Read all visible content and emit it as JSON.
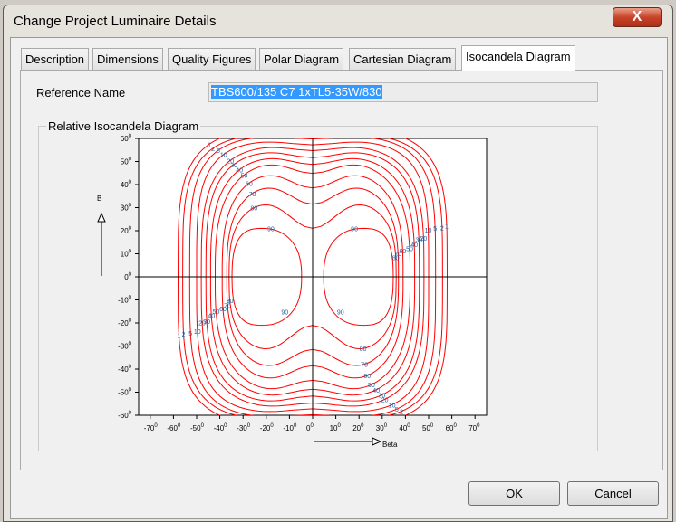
{
  "window": {
    "title": "Change Project Luminaire Details",
    "close_label": "X"
  },
  "tabs": [
    {
      "label": "Description"
    },
    {
      "label": "Dimensions"
    },
    {
      "label": "Quality Figures"
    },
    {
      "label": "Polar Diagram"
    },
    {
      "label": "Cartesian Diagram"
    },
    {
      "label": "Isocandela Diagram",
      "active": true
    }
  ],
  "form": {
    "reference_label": "Reference Name",
    "reference_value": "TBS600/135 C7 1xTL5-35W/830"
  },
  "group": {
    "title": "Relative Isocandela Diagram"
  },
  "chart_data": {
    "type": "contour",
    "xlabel": "Beta",
    "ylabel": "B",
    "xlim": [
      -75,
      75
    ],
    "ylim": [
      -60,
      60
    ],
    "xticks": [
      -70,
      -60,
      -50,
      -40,
      -30,
      -20,
      -10,
      0,
      10,
      20,
      30,
      40,
      50,
      60,
      70
    ],
    "yticks": [
      60,
      50,
      40,
      30,
      20,
      10,
      0,
      -10,
      -20,
      -30,
      -40,
      -50,
      -60
    ],
    "tick_suffix": "0",
    "levels": [
      1,
      2,
      5,
      10,
      20,
      30,
      40,
      50,
      60,
      70,
      80,
      90
    ],
    "line_color": "#ff0000",
    "label_color": "#1f5fa0"
  },
  "buttons": {
    "ok": "OK",
    "cancel": "Cancel"
  }
}
